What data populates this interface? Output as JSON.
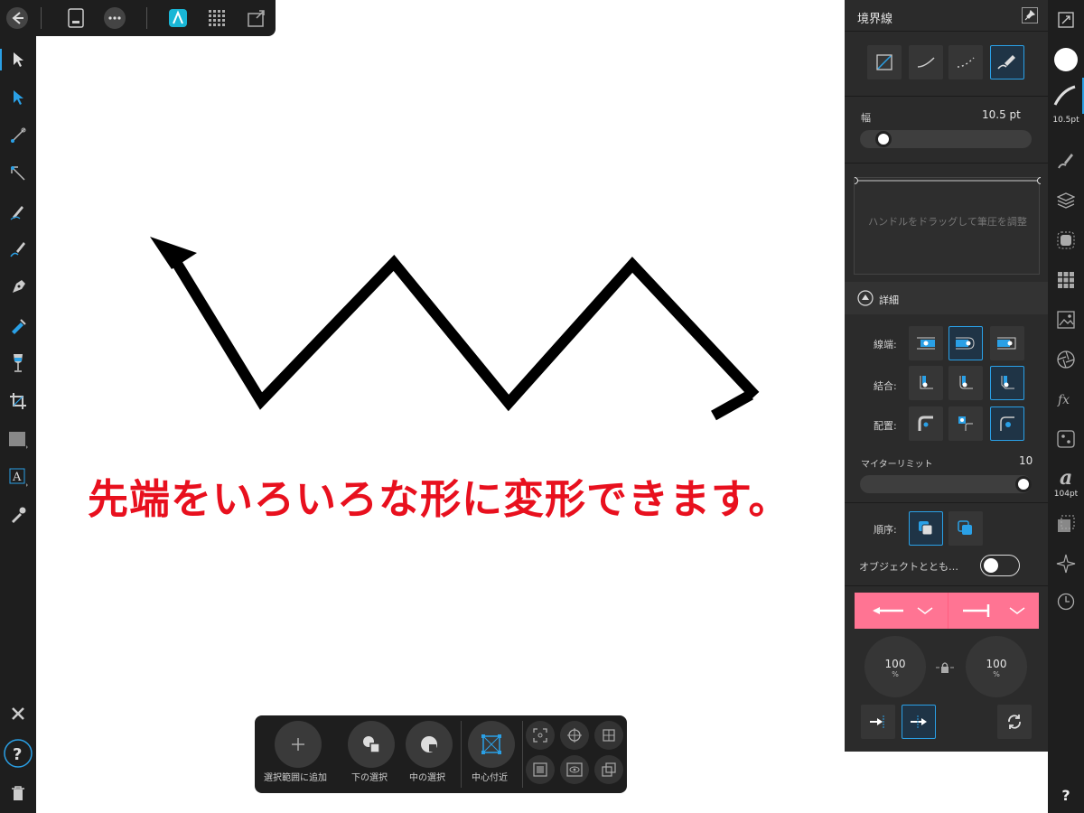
{
  "canvas": {
    "annotation": "先端をいろいろな形に変形できます。"
  },
  "context_toolbar": {
    "add_to_selection": "選択範囲に追加",
    "select_under": "下の選択",
    "select_inside": "中の選択",
    "near_center": "中心付近"
  },
  "stroke_panel": {
    "title": "境界線",
    "width_label": "幅",
    "width_value": "10.5 pt",
    "width_level": 0.13,
    "pressure_hint": "ハンドルをドラッグして筆圧を調整",
    "details_label": "詳細",
    "cap_label": "線端:",
    "join_label": "結合:",
    "align_label": "配置:",
    "miter_label": "マイターリミット",
    "miter_value": "10",
    "order_label": "順序:",
    "scale_with_object_label": "オブジェクトととも…",
    "start_scale_value": "100",
    "start_scale_unit": "%",
    "end_scale_value": "100",
    "end_scale_unit": "%"
  },
  "right_bar": {
    "stroke_width_label": "10.5pt",
    "font_size_label": "104pt",
    "help_label": "?"
  },
  "colors": {
    "accent": "#2aa0e6",
    "annotation_red": "#e8101e",
    "arrowhead_bar": "#ff7493"
  }
}
